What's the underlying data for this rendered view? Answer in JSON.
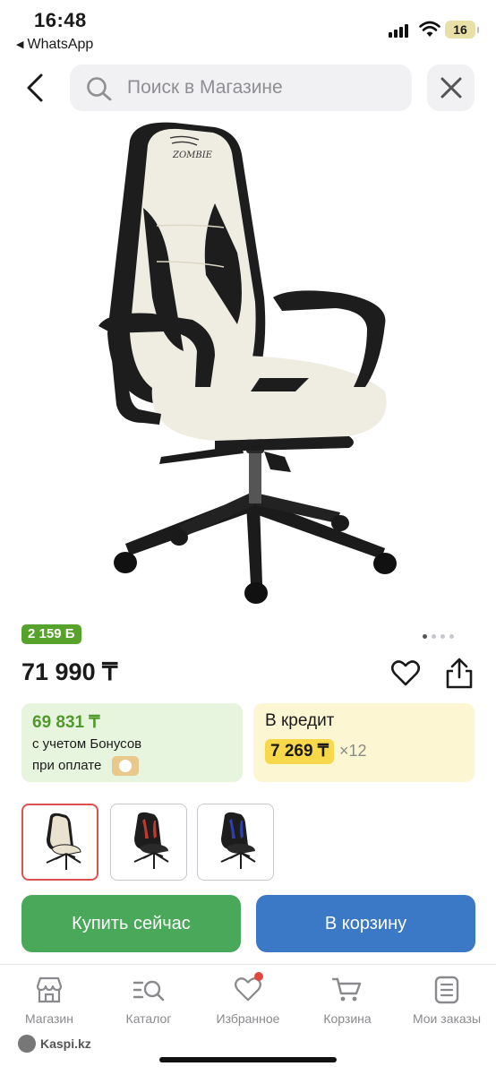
{
  "status_bar": {
    "time": "16:48",
    "back_app": "WhatsApp",
    "battery": "16"
  },
  "header": {
    "search_placeholder": "Поиск в Магазине",
    "back_icon": "chevron-left-icon",
    "search_icon": "search-icon",
    "close_icon": "close-icon"
  },
  "product": {
    "bonus_badge": "2 159 Б",
    "price": "71 990 ₸",
    "image_dots": 4,
    "image_dot_active": 0,
    "bonus_card": {
      "amount": "69 831 ₸",
      "line1": "с учетом Бонусов",
      "line2": "при оплате"
    },
    "credit_card": {
      "label": "В кредит",
      "monthly": "7 269 ₸",
      "term": "×12"
    },
    "variants": [
      {
        "color": "white",
        "accent": "#e8e2cf",
        "selected": true
      },
      {
        "color": "red",
        "accent": "#c0392b",
        "selected": false
      },
      {
        "color": "blue",
        "accent": "#2f3fae",
        "selected": false
      }
    ],
    "buy_now": "Купить сейчас",
    "add_to_cart": "В корзину"
  },
  "tabbar": {
    "items": [
      {
        "label": "Магазин",
        "icon": "store-icon"
      },
      {
        "label": "Каталог",
        "icon": "catalog-search-icon"
      },
      {
        "label": "Избранное",
        "icon": "heart-icon",
        "badge_dot": true
      },
      {
        "label": "Корзина",
        "icon": "cart-icon"
      },
      {
        "label": "Мои заказы",
        "icon": "orders-icon"
      }
    ]
  },
  "footer": {
    "brand": "Kaspi.kz"
  },
  "colors": {
    "green_accent": "#57a22a",
    "buy_button": "#4aa85a",
    "cart_button": "#3b78c6",
    "credit_highlight": "#f7d84a",
    "selected_border": "#d9534f"
  }
}
